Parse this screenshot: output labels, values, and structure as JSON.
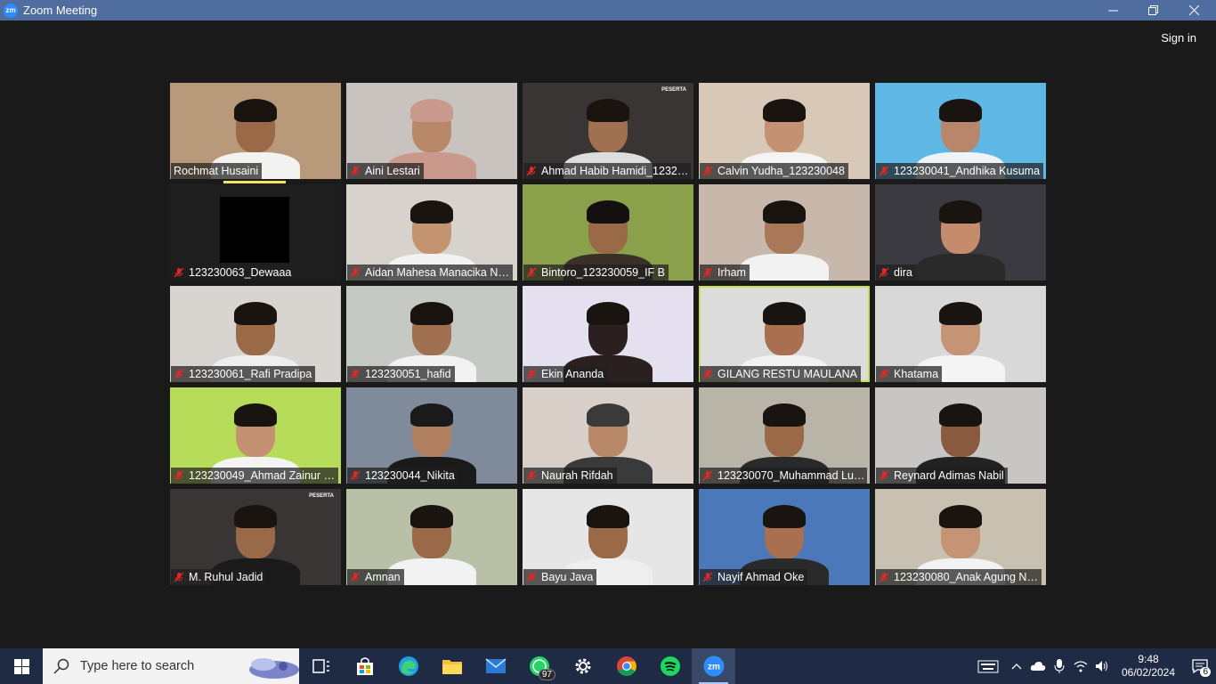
{
  "window": {
    "app_icon_text": "zm",
    "title": "Zoom Meeting"
  },
  "meeting": {
    "sign_in_label": "Sign in"
  },
  "participants": [
    {
      "name": "Rochmat Husaini",
      "muted": false,
      "bg": "#b89a7a",
      "skin": "#9a6a48",
      "shirt": "#f2f2f0",
      "hair": "#1a1410"
    },
    {
      "name": "Aini Lestari",
      "muted": true,
      "bg": "#c9c3c0",
      "skin": "#b88868",
      "shirt": "#c99a8c",
      "hair": "#c99a8c"
    },
    {
      "name": "Ahmad Habib Hamidi_1232…",
      "muted": true,
      "bg": "#3a3535",
      "skin": "#a07050",
      "shirt": "#ddd",
      "hair": "#1a1410",
      "banner": "PESERTA"
    },
    {
      "name": "Calvin Yudha_123230048",
      "muted": true,
      "bg": "#d7c8b8",
      "skin": "#c49272",
      "shirt": "#f4f4f4",
      "hair": "#1a1410"
    },
    {
      "name": "123230041_Andhika Kusuma",
      "muted": true,
      "bg": "#5fb7e6",
      "skin": "#b8866a",
      "shirt": "#eef4f8",
      "hair": "#1a1410"
    },
    {
      "name": "123230063_Dewaaa",
      "muted": true,
      "bg": "#1e1e1e",
      "skin": "#000",
      "shirt": "#000",
      "hair": "#000",
      "blank": true
    },
    {
      "name": "Aidan Mahesa Manacika N…",
      "muted": true,
      "bg": "#d8d2cc",
      "skin": "#c49470",
      "shirt": "#f3f3f3",
      "hair": "#1a1410"
    },
    {
      "name": "Bintoro_123230059_IF B",
      "muted": true,
      "bg": "#8aa04a",
      "skin": "#9a6a48",
      "shirt": "#3a3028",
      "hair": "#141010"
    },
    {
      "name": "Irham",
      "muted": true,
      "bg": "#c8b8ac",
      "skin": "#a87858",
      "shirt": "#f2f2f2",
      "hair": "#1a1410"
    },
    {
      "name": "dira",
      "muted": true,
      "bg": "#3a3a40",
      "skin": "#c48c6c",
      "shirt": "#2a2a2a",
      "hair": "#1a1410"
    },
    {
      "name": "123230061_Rafi Pradipa",
      "muted": true,
      "bg": "#d8d4d0",
      "skin": "#9a6a48",
      "shirt": "#eee",
      "hair": "#1a1410"
    },
    {
      "name": "123230051_hafid",
      "muted": true,
      "bg": "#c6c8c4",
      "skin": "#a07050",
      "shirt": "#f2f2f2",
      "hair": "#1a1410"
    },
    {
      "name": "Ekin Ananda",
      "muted": true,
      "bg": "#e4e0f0",
      "skin": "#2a2020",
      "shirt": "#2a2020",
      "hair": "#1a1410"
    },
    {
      "name": "GILANG RESTU MAULANA",
      "muted": true,
      "bg": "#dcdcdc",
      "skin": "#a87050",
      "shirt": "#f2f2f2",
      "hair": "#1a1410",
      "active": true
    },
    {
      "name": "Khatama",
      "muted": true,
      "bg": "#d8d8d8",
      "skin": "#c49474",
      "shirt": "#f4f4f4",
      "hair": "#1a1410"
    },
    {
      "name": "123230049_Ahmad Zainur …",
      "muted": true,
      "bg": "#b6dc5a",
      "skin": "#c49272",
      "shirt": "#f4f4f4",
      "hair": "#1a1410"
    },
    {
      "name": "123230044_Nikita",
      "muted": true,
      "bg": "#7f8a9a",
      "skin": "#b08060",
      "shirt": "#1a1a1a",
      "hair": "#1a1a1a"
    },
    {
      "name": "Naurah Rifdah",
      "muted": true,
      "bg": "#d8d0c8",
      "skin": "#b88868",
      "shirt": "#3a3a3a",
      "hair": "#3a3a3a"
    },
    {
      "name": "123230070_Muhammad Lu…",
      "muted": true,
      "bg": "#b8b4a8",
      "skin": "#9a6a48",
      "shirt": "#2a2a2a",
      "hair": "#1a1410"
    },
    {
      "name": "Reynard Adimas Nabil",
      "muted": true,
      "bg": "#c8c6c4",
      "skin": "#8a5a3e",
      "shirt": "#222",
      "hair": "#1a1410"
    },
    {
      "name": "M. Ruhul Jadid",
      "muted": true,
      "bg": "#3a3535",
      "skin": "#9a6a48",
      "shirt": "#1a1a1a",
      "hair": "#1a1410",
      "banner": "PESERTA"
    },
    {
      "name": "Amnan",
      "muted": true,
      "bg": "#b8c0a8",
      "skin": "#9a6a48",
      "shirt": "#f2f2f2",
      "hair": "#1a1410"
    },
    {
      "name": "Bayu Java",
      "muted": true,
      "bg": "#e6e6e6",
      "skin": "#9a6a48",
      "shirt": "#eee",
      "hair": "#1a1410"
    },
    {
      "name": "Nayif Ahmad Oke",
      "muted": true,
      "bg": "#4a78b8",
      "skin": "#a87050",
      "shirt": "#2a2a2a",
      "hair": "#1a1410"
    },
    {
      "name": "123230080_Anak Agung N…",
      "muted": true,
      "bg": "#c8c0b0",
      "skin": "#c49474",
      "shirt": "#f2f2f2",
      "hair": "#1a1410"
    }
  ],
  "taskbar": {
    "search_placeholder": "Type here to search",
    "whatsapp_badge": "97",
    "time": "9:48",
    "date": "06/02/2024",
    "notifications": "6"
  },
  "colors": {
    "titlebar": "#4f6d9f",
    "taskbar": "#1f2a44",
    "active_speaker": "#c8e24a",
    "mute": "#e02828"
  }
}
